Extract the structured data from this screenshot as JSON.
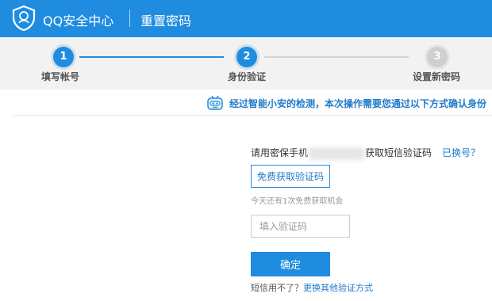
{
  "header": {
    "brand": "QQ安全中心",
    "page_title": "重置密码",
    "colors": {
      "primary": "#1f8ce0",
      "text": "#ffffff"
    }
  },
  "steps": [
    {
      "number": "1",
      "label": "填写帐号",
      "state": "completed"
    },
    {
      "number": "2",
      "label": "身份验证",
      "state": "current"
    },
    {
      "number": "3",
      "label": "设置新密码",
      "state": "pending"
    }
  ],
  "notice": {
    "icon": "robot-icon",
    "text": "经过智能小安的检测，本次操作需要您通过以下方式确认身份"
  },
  "form": {
    "phone_prefix": "请用密保手机",
    "phone_suffix": "获取短信验证码",
    "change_link": "已换号？",
    "get_code_button": "免费获取验证码",
    "hint": "今天还有1次免费获取机会",
    "code_input": {
      "placeholder": "填入验证码",
      "value": ""
    },
    "confirm_button": "确定",
    "sms_unavailable": "短信用不了？",
    "other_methods_link": "更换其他验证方式"
  }
}
